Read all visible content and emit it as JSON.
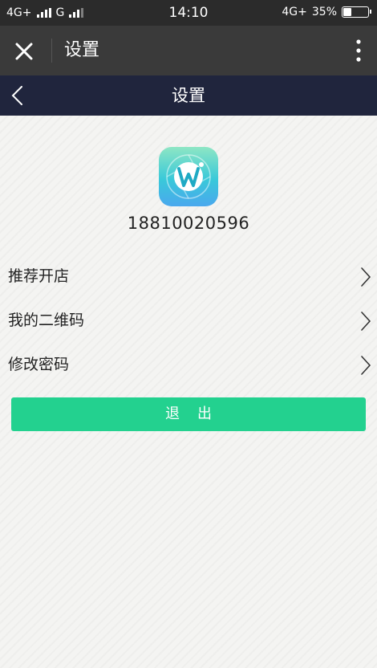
{
  "status_bar": {
    "left_network_1": "4G+",
    "left_network_2": "G",
    "time": "14:10",
    "right_network": "4G+",
    "battery": "35%",
    "battery_level": 0.35
  },
  "app_bar": {
    "title": "设置"
  },
  "nav_bar": {
    "title": "设置"
  },
  "profile": {
    "phone": "18810020596"
  },
  "menu": {
    "items": [
      {
        "label": "推荐开店"
      },
      {
        "label": "我的二维码"
      },
      {
        "label": "修改密码"
      }
    ]
  },
  "logout_label": "退出",
  "colors": {
    "status_bar": "#2b2b2b",
    "app_bar": "#3a3a3a",
    "nav_bar": "#20253d",
    "accent": "#23d18f"
  }
}
